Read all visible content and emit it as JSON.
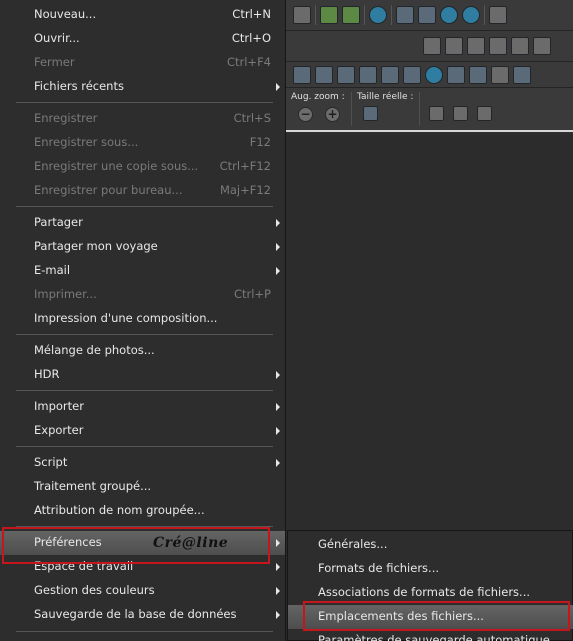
{
  "file_menu": {
    "items": [
      {
        "label": "Nouveau...",
        "shortcut": "Ctrl+N"
      },
      {
        "label": "Ouvrir...",
        "shortcut": "Ctrl+O"
      },
      {
        "label": "Fermer",
        "shortcut": "Ctrl+F4"
      },
      {
        "label": "Fichiers récents"
      },
      {
        "label": "Enregistrer",
        "shortcut": "Ctrl+S"
      },
      {
        "label": "Enregistrer sous...",
        "shortcut": "F12"
      },
      {
        "label": "Enregistrer une copie sous...",
        "shortcut": "Ctrl+F12"
      },
      {
        "label": "Enregistrer pour bureau...",
        "shortcut": "Maj+F12"
      },
      {
        "label": "Partager"
      },
      {
        "label": "Partager mon voyage"
      },
      {
        "label": "E-mail"
      },
      {
        "label": "Imprimer...",
        "shortcut": "Ctrl+P"
      },
      {
        "label": "Impression d'une composition..."
      },
      {
        "label": "Mélange de photos..."
      },
      {
        "label": "HDR"
      },
      {
        "label": "Importer"
      },
      {
        "label": "Exporter"
      },
      {
        "label": "Script"
      },
      {
        "label": "Traitement groupé..."
      },
      {
        "label": "Attribution de nom groupée..."
      },
      {
        "label": "Préférences"
      },
      {
        "label": "Espace de travail"
      },
      {
        "label": "Gestion des couleurs"
      },
      {
        "label": "Sauvegarde de la base de données"
      }
    ]
  },
  "submenu": {
    "items": [
      {
        "label": "Générales..."
      },
      {
        "label": "Formats de fichiers..."
      },
      {
        "label": "Associations de formats de fichiers..."
      },
      {
        "label": "Emplacements des fichiers..."
      },
      {
        "label": "Paramètres de sauvegarde automatique..."
      }
    ]
  },
  "watermark": "Cré@line",
  "zoom_panel": {
    "zoom_label": "Aug. zoom :",
    "size_label": "Taille réelle :",
    "zoom_out": "−",
    "zoom_in": "+"
  },
  "colors": {
    "menu_bg": "#2d2d2d",
    "highlight": "#5a5a5a",
    "annotation_red": "#c4161c",
    "disabled_text": "#7a7a7a"
  },
  "icons": [
    "image-icon",
    "undo-icon",
    "redo-icon",
    "info-icon",
    "actual-size-icon",
    "fit-icon",
    "zoom-out-icon",
    "zoom-in-icon",
    "copy-icon",
    "paste-icon",
    "cut-icon",
    "rotate-icon",
    "crop-icon",
    "settings-icon"
  ]
}
